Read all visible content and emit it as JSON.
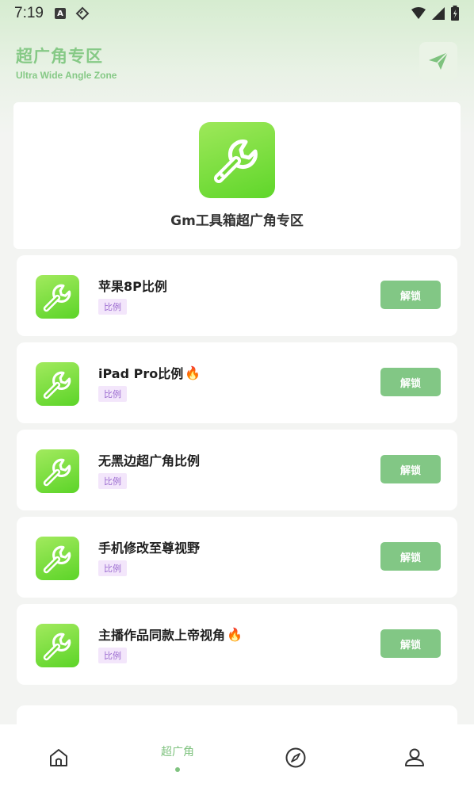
{
  "status_bar": {
    "time": "7:19",
    "notif_icons": [
      "a-badge-icon",
      "diamond-icon"
    ],
    "right_icons": [
      "wifi-icon",
      "signal-icon",
      "battery-icon"
    ]
  },
  "header": {
    "title": "超广角专区",
    "subtitle": "Ultra Wide Angle Zone",
    "action_icon": "send-icon"
  },
  "hero": {
    "name": "Gm工具箱超广角专区",
    "logo_icon": "wrench-icon"
  },
  "items": [
    {
      "label": "苹果8P比例",
      "hot": false,
      "tag": "比例",
      "button": "解锁"
    },
    {
      "label": "iPad Pro比例",
      "hot": true,
      "tag": "比例",
      "button": "解锁"
    },
    {
      "label": "无黑边超广角比例",
      "hot": false,
      "tag": "比例",
      "button": "解锁"
    },
    {
      "label": "手机修改至尊视野",
      "hot": false,
      "tag": "比例",
      "button": "解锁"
    },
    {
      "label": "主播作品同款上帝视角",
      "hot": true,
      "tag": "比例",
      "button": "解锁"
    }
  ],
  "bottom_nav": [
    {
      "icon": "home-icon",
      "label": ""
    },
    {
      "icon": "",
      "label": "超广角",
      "active": true
    },
    {
      "icon": "compass-icon",
      "label": ""
    },
    {
      "icon": "profile-icon",
      "label": ""
    }
  ],
  "colors": {
    "accent": "#82c785",
    "tag_bg": "#f3e6fb",
    "tag_text": "#9b6bd0",
    "icon_green": "#6edb30"
  }
}
